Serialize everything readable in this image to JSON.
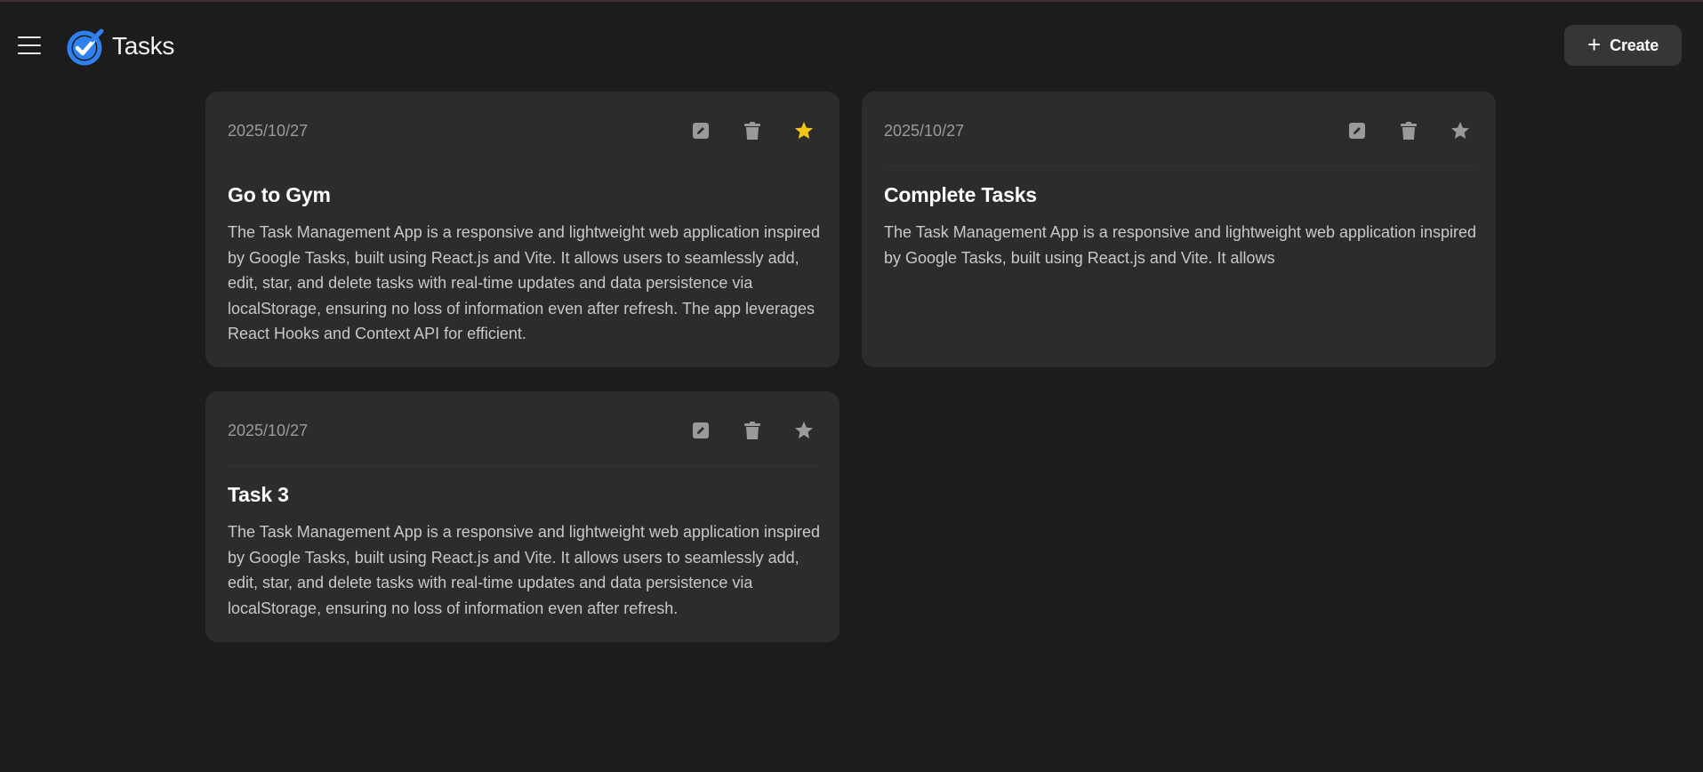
{
  "header": {
    "app_title": "Tasks",
    "create_label": "Create",
    "logo_icon": "tasks-check-logo",
    "menu_icon": "hamburger-menu-icon"
  },
  "colors": {
    "background": "#1c1c1c",
    "card": "#2c2c2c",
    "accent_blue": "#2f80f0",
    "star_active": "#f5c518",
    "icon_muted": "#9a9a9a"
  },
  "tasks": [
    {
      "date": "2025/10/27",
      "title": "Go to Gym",
      "description": "The Task Management App is a responsive and lightweight web application inspired by Google Tasks, built using React.js and Vite. It allows users to seamlessly add, edit, star, and delete tasks with real-time updates and data persistence via localStorage, ensuring no loss of information even after refresh. The app leverages React Hooks and Context API for efficient.",
      "starred": true
    },
    {
      "date": "2025/10/27",
      "title": "Complete Tasks",
      "description": "The Task Management App is a responsive and lightweight web application inspired by Google Tasks, built using React.js and Vite. It allows",
      "starred": false
    },
    {
      "date": "2025/10/27",
      "title": "Task 3",
      "description": "The Task Management App is a responsive and lightweight web application inspired by Google Tasks, built using React.js and Vite. It allows users to seamlessly add, edit, star, and delete tasks with real-time updates and data persistence via localStorage, ensuring no loss of information even after refresh.",
      "starred": false
    }
  ]
}
